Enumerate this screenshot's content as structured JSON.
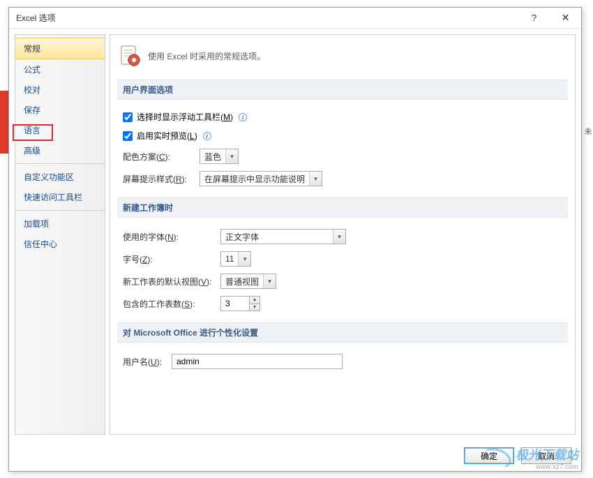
{
  "window": {
    "title": "Excel 选项"
  },
  "sidebar": {
    "items": [
      {
        "label": "常规",
        "selected": true
      },
      {
        "label": "公式"
      },
      {
        "label": "校对"
      },
      {
        "label": "保存"
      },
      {
        "label": "语言"
      },
      {
        "label": "高级",
        "highlighted": true
      },
      {
        "label": "自定义功能区"
      },
      {
        "label": "快速访问工具栏"
      },
      {
        "label": "加载项"
      },
      {
        "label": "信任中心"
      }
    ]
  },
  "header": {
    "text": "使用 Excel 时采用的常规选项。"
  },
  "sections": {
    "ui_options": {
      "title": "用户界面选项",
      "mini_toolbar": {
        "label_before": "选择时显示浮动工具栏(",
        "shortcut": "M",
        "label_after": ")",
        "checked": true
      },
      "live_preview": {
        "label_before": "启用实时预览(",
        "shortcut": "L",
        "label_after": ")",
        "checked": true
      },
      "color_scheme": {
        "label_before": "配色方案(",
        "shortcut": "C",
        "label_after": "):",
        "value": "蓝色"
      },
      "screentip": {
        "label_before": "屏幕提示样式(",
        "shortcut": "R",
        "label_after": "):",
        "value": "在屏幕提示中显示功能说明"
      }
    },
    "new_workbook": {
      "title": "新建工作簿时",
      "font": {
        "label_before": "使用的字体(",
        "shortcut": "N",
        "label_after": "):",
        "value": "正文字体"
      },
      "font_size": {
        "label_before": "字号(",
        "shortcut": "Z",
        "label_after": "):",
        "value": "11"
      },
      "default_view": {
        "label_before": "新工作表的默认视图(",
        "shortcut": "V",
        "label_after": "):",
        "value": "普通视图"
      },
      "sheet_count": {
        "label_before": "包含的工作表数(",
        "shortcut": "S",
        "label_after": "):",
        "value": "3"
      }
    },
    "personalize": {
      "title": "对 Microsoft Office 进行个性化设置",
      "username": {
        "label_before": "用户名(",
        "shortcut": "U",
        "label_after": "):",
        "value": "admin"
      }
    }
  },
  "footer": {
    "ok": "确定",
    "cancel": "取消"
  },
  "watermark": {
    "main": "极光下载站",
    "sub": "www.xz7.com"
  },
  "bg": {
    "col_label": "未"
  }
}
